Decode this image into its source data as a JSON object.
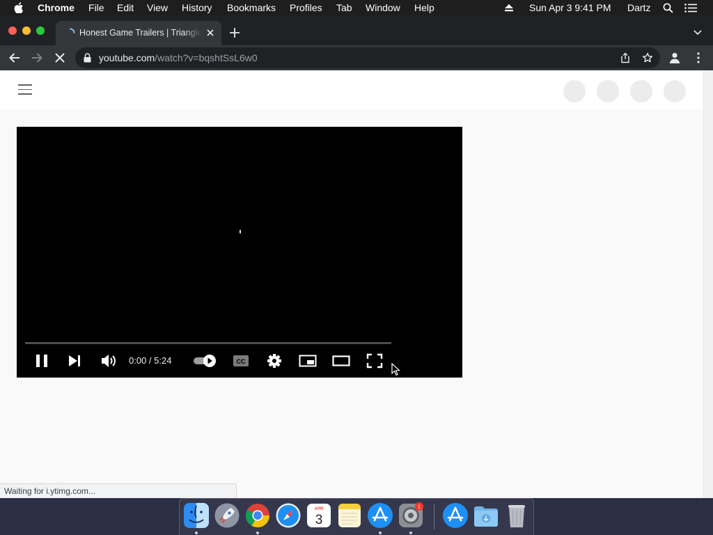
{
  "menubar": {
    "app_name": "Chrome",
    "menus": [
      "File",
      "Edit",
      "View",
      "History",
      "Bookmarks",
      "Profiles",
      "Tab",
      "Window",
      "Help"
    ],
    "clock": "Sun Apr 3  9:41 PM",
    "user": "Dartz"
  },
  "browser": {
    "tab_title": "Honest Game Trailers | Triangle Strategy",
    "url_host": "youtube.com",
    "url_path": "/watch?v=bqshtSsL6w0",
    "status_text": "Waiting for i.ytimg.com..."
  },
  "player": {
    "time": "0:00 / 5:24",
    "cc_label": "CC",
    "progress": 0
  },
  "dock": {
    "calendar_month": "APR",
    "calendar_day": "3",
    "settings_badge": "1"
  },
  "colors": {
    "menubar_bg": "#1e1e1e",
    "tabstrip_bg": "#202124",
    "toolbar_bg": "#35363a",
    "close": "#ff5f57",
    "minimize": "#febc2e",
    "maximize": "#28c840"
  }
}
